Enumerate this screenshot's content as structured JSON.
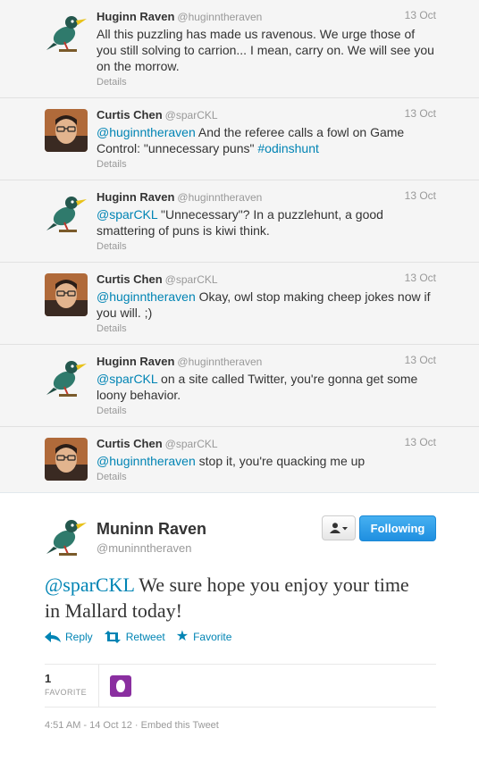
{
  "thread": [
    {
      "name": "Huginn Raven",
      "handle": "@huginntheraven",
      "time": "13 Oct",
      "avatar": "raven",
      "parts": [
        {
          "t": "All this puzzling has made us ravenous. We urge those of you still solving to carrion... I mean, carry on. We will see you on the morrow.",
          "k": ""
        }
      ],
      "details": "Details"
    },
    {
      "name": "Curtis Chen",
      "handle": "@sparCKL",
      "time": "13 Oct",
      "avatar": "person",
      "parts": [
        {
          "t": "@huginntheraven",
          "k": "mention"
        },
        {
          "t": " And the referee calls a fowl on Game Control: \"unnecessary puns\" ",
          "k": ""
        },
        {
          "t": "#odinshunt",
          "k": "hashtag"
        }
      ],
      "details": "Details"
    },
    {
      "name": "Huginn Raven",
      "handle": "@huginntheraven",
      "time": "13 Oct",
      "avatar": "raven",
      "parts": [
        {
          "t": "@sparCKL",
          "k": "mention"
        },
        {
          "t": " \"Unnecessary\"? In a puzzlehunt, a good smattering of puns is kiwi think.",
          "k": ""
        }
      ],
      "details": "Details"
    },
    {
      "name": "Curtis Chen",
      "handle": "@sparCKL",
      "time": "13 Oct",
      "avatar": "person",
      "parts": [
        {
          "t": "@huginntheraven",
          "k": "mention"
        },
        {
          "t": " Okay, owl stop making cheep jokes now if you will. ;)",
          "k": ""
        }
      ],
      "details": "Details"
    },
    {
      "name": "Huginn Raven",
      "handle": "@huginntheraven",
      "time": "13 Oct",
      "avatar": "raven",
      "parts": [
        {
          "t": "@sparCKL",
          "k": "mention"
        },
        {
          "t": " on a site called Twitter, you're gonna get some loony behavior.",
          "k": ""
        }
      ],
      "details": "Details"
    },
    {
      "name": "Curtis Chen",
      "handle": "@sparCKL",
      "time": "13 Oct",
      "avatar": "person",
      "parts": [
        {
          "t": "@huginntheraven",
          "k": "mention"
        },
        {
          "t": " stop it, you're quacking me up",
          "k": ""
        }
      ],
      "details": "Details"
    }
  ],
  "main": {
    "name": "Muninn Raven",
    "handle": "@muninntheraven",
    "following_label": "Following",
    "text_mention": "@sparCKL",
    "text_body": " We sure hope you enjoy your time in Mallard today!",
    "reply_label": "Reply",
    "retweet_label": "Retweet",
    "favorite_label": "Favorite",
    "favorite_count": "1",
    "favorite_stat_label": "FAVORITE",
    "timestamp": "4:51 AM - 14 Oct 12",
    "separator": " · ",
    "embed_label": "Embed this Tweet"
  },
  "colors": {
    "link": "#0084b4",
    "follow_button": "#2b9be8",
    "fav_avatar": "#8a2fa0"
  }
}
